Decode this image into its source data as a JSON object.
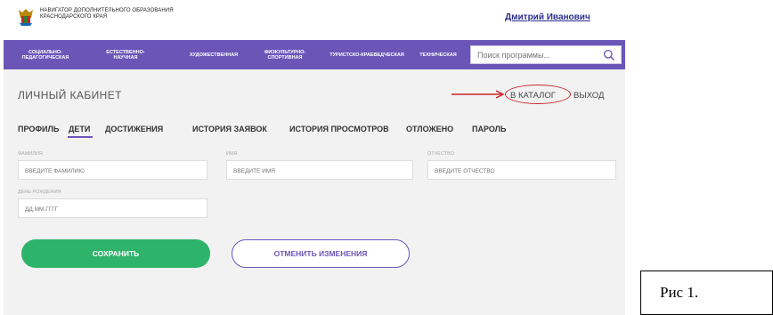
{
  "header": {
    "org_name": "НАВИГАТОР ДОПОЛНИТЕЛЬНОГО ОБРАЗОВАНИЯ КРАСНОДАРСКОГО КРАЯ",
    "user_name": "Дмитрий Иванович"
  },
  "nav": {
    "items": [
      {
        "label": "СОЦИАЛЬНО-ПЕДАГОГИЧЕСКАЯ"
      },
      {
        "label": "ЕСТЕСТВЕННО-НАУЧНАЯ"
      },
      {
        "label": "ХУДОЖЕСТВЕННАЯ"
      },
      {
        "label": "ФИЗКУЛЬТУРНО-СПОРТИВНАЯ"
      },
      {
        "label": "ТУРИСТСКО-КРАЕВЕДЧЕСКАЯ"
      },
      {
        "label": "ТЕХНИЧЕСКАЯ"
      }
    ],
    "search_placeholder": "Поиск программы..."
  },
  "page": {
    "title": "ЛИЧНЫЙ КАБИНЕТ",
    "catalog_link": "В КАТАЛОГ",
    "logout_link": "ВЫХОД"
  },
  "tabs": [
    {
      "label": "ПРОФИЛЬ"
    },
    {
      "label": "ДЕТИ"
    },
    {
      "label": "ДОСТИЖЕНИЯ"
    },
    {
      "label": "ИСТОРИЯ ЗАЯВОК"
    },
    {
      "label": "ИСТОРИЯ ПРОСМОТРОВ"
    },
    {
      "label": "ОТЛОЖЕНО"
    },
    {
      "label": "ПАРОЛЬ"
    }
  ],
  "active_tab": "ДЕТИ",
  "form": {
    "surname_label": "ФАМИЛИЯ",
    "surname_placeholder": "ВВЕДИТЕ ФАМИЛИЮ",
    "name_label": "ИМЯ",
    "name_placeholder": "ВВЕДИТЕ ИМЯ",
    "patronymic_label": "ОТЧЕСТВО",
    "patronymic_placeholder": "ВВЕДИТЕ ОТЧЕСТВО",
    "birthday_label": "ДЕНЬ РОЖДЕНИЯ",
    "birthday_placeholder": "ДД.ММ.ГГГГ"
  },
  "buttons": {
    "save": "СОХРАНИТЬ",
    "cancel": "ОТМЕНИТЬ ИЗМЕНЕНИЯ"
  },
  "caption": "Рис 1.",
  "colors": {
    "accent": "#6b56b8",
    "save": "#2db46a",
    "annotation": "#c8262b",
    "user_link": "#2b2e8f"
  },
  "icons": {
    "logo": "coat-of-arms-icon",
    "search": "search-icon",
    "arrow": "arrow-right-icon"
  }
}
